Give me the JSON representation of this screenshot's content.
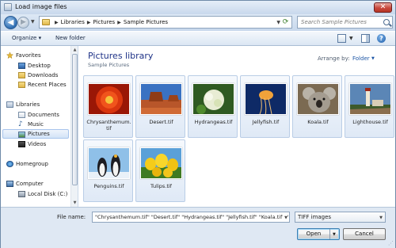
{
  "window": {
    "title": "Load image files",
    "close_glyph": "✕"
  },
  "nav": {
    "back_glyph": "◀",
    "forward_glyph": "▶",
    "breadcrumb": [
      "Libraries",
      "Pictures",
      "Sample Pictures"
    ],
    "separator": "▶",
    "search_placeholder": "Search Sample Pictures"
  },
  "toolbar": {
    "organize": "Organize ▾",
    "new_folder": "New folder",
    "help_glyph": "?"
  },
  "sidebar": {
    "items": [
      {
        "label": "Favorites",
        "icon": "star-icon"
      },
      {
        "label": "Desktop",
        "icon": "desktop-icon"
      },
      {
        "label": "Downloads",
        "icon": "downloads-icon"
      },
      {
        "label": "Recent Places",
        "icon": "recent-places-icon"
      },
      {
        "label": "Libraries",
        "icon": "libraries-icon"
      },
      {
        "label": "Documents",
        "icon": "documents-icon"
      },
      {
        "label": "Music",
        "icon": "music-icon"
      },
      {
        "label": "Pictures",
        "icon": "pictures-icon"
      },
      {
        "label": "Videos",
        "icon": "videos-icon"
      },
      {
        "label": "Homegroup",
        "icon": "homegroup-icon"
      },
      {
        "label": "Computer",
        "icon": "computer-icon"
      },
      {
        "label": "Local Disk (C:)",
        "icon": "disk-icon"
      }
    ],
    "selected": "Pictures"
  },
  "library": {
    "title": "Pictures library",
    "subtitle": "Sample Pictures",
    "arrange_label": "Arrange by:",
    "arrange_value": "Folder"
  },
  "files": [
    {
      "name": "Chrysanthemum.tif",
      "label_line1": "Chrysanthemum.",
      "label_line2": "tif"
    },
    {
      "name": "Desert.tif",
      "label_line1": "Desert.tif",
      "label_line2": ""
    },
    {
      "name": "Hydrangeas.tif",
      "label_line1": "Hydrangeas.tif",
      "label_line2": ""
    },
    {
      "name": "Jellyfish.tif",
      "label_line1": "Jellyfish.tif",
      "label_line2": ""
    },
    {
      "name": "Koala.tif",
      "label_line1": "Koala.tif",
      "label_line2": ""
    },
    {
      "name": "Lighthouse.tif",
      "label_line1": "Lighthouse.tif",
      "label_line2": ""
    },
    {
      "name": "Penguins.tif",
      "label_line1": "Penguins.tif",
      "label_line2": ""
    },
    {
      "name": "Tulips.tif",
      "label_line1": "Tulips.tif",
      "label_line2": ""
    }
  ],
  "bottom": {
    "file_name_label": "File name:",
    "file_name_value": "\"Chrysanthemum.tif\" \"Desert.tif\" \"Hydrangeas.tif\" \"Jellyfish.tif\" \"Koala.tif\" \"",
    "file_type_value": "TIFF images",
    "open_label": "Open",
    "cancel_label": "Cancel"
  }
}
